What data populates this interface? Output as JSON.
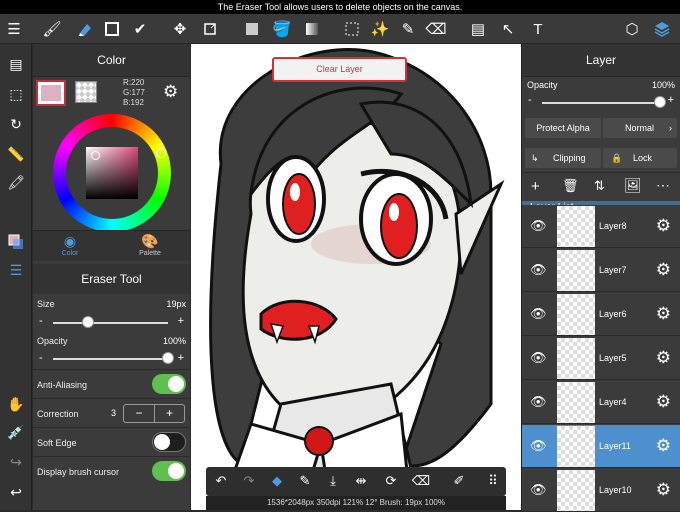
{
  "top_notice": "The Eraser Tool allows users to delete objects on the canvas.",
  "color_panel": {
    "title": "Color",
    "rgb_r": "R:220",
    "rgb_g": "G:177",
    "rgb_b": "B:192",
    "foreground_color": "#dcb1c0",
    "tab_color": "Color",
    "tab_palette": "Palette"
  },
  "tool_panel": {
    "title": "Eraser Tool",
    "size_label": "Size",
    "size_value": "19px",
    "size_fraction": 0.3,
    "opacity_label": "Opacity",
    "opacity_value": "100%",
    "opacity_fraction": 1.0,
    "anti_aliasing_label": "Anti-Aliasing",
    "anti_aliasing_on": true,
    "correction_label": "Correction",
    "correction_value": "3",
    "soft_edge_label": "Soft Edge",
    "soft_edge_on": false,
    "display_cursor_label": "Display brush cursor",
    "display_cursor_on": true
  },
  "canvas": {
    "clear_layer_button": "Clear Layer"
  },
  "layer_panel": {
    "title": "Layer",
    "opacity_label": "Opacity",
    "opacity_value": "100%",
    "opacity_fraction": 1.0,
    "protect_alpha": "Protect Alpha",
    "blend_mode": "Normal",
    "clipping": "Clipping",
    "lock": "Lock",
    "list_title": "Layer List",
    "layers": [
      {
        "name": "Layer8",
        "selected": false
      },
      {
        "name": "Layer7",
        "selected": false
      },
      {
        "name": "Layer6",
        "selected": false
      },
      {
        "name": "Layer5",
        "selected": false
      },
      {
        "name": "Layer4",
        "selected": false
      },
      {
        "name": "Layer11",
        "selected": true
      },
      {
        "name": "Layer10",
        "selected": false
      }
    ]
  },
  "status_bar": "1536*2048px 350dpi 121% 12° Brush: 19px 100%",
  "accent_color": "#4d90cd",
  "toggle_on_color": "#5fbf4f"
}
